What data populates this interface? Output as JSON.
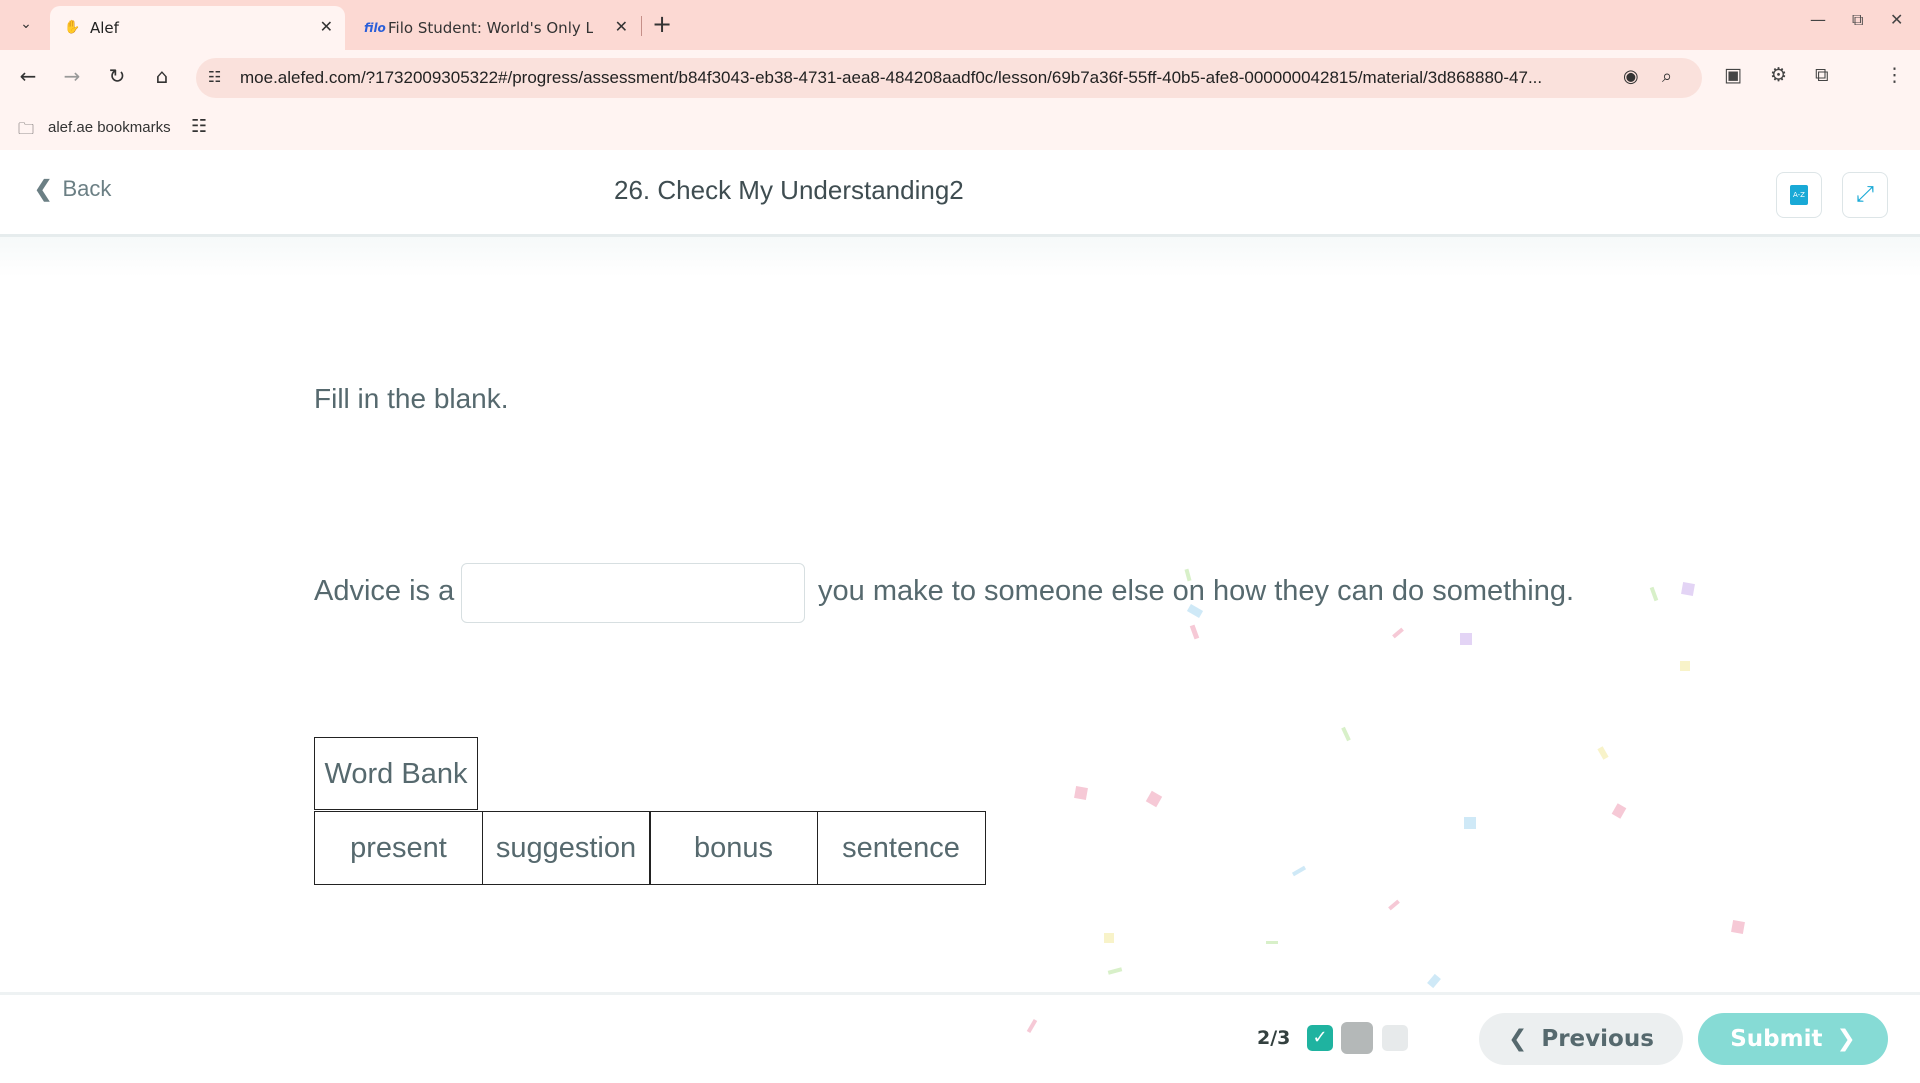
{
  "browser": {
    "tabs": [
      {
        "title": "Alef",
        "favicon": "alef-icon",
        "active": true
      },
      {
        "title": "Filo Student: World's Only Live I",
        "favicon": "filo",
        "active": false
      }
    ],
    "url": "moe.alefed.com/?1732009305322#/progress/assessment/b84f3043-eb38-4731-aea8-484208aadf0c/lesson/69b7a36f-55ff-40b5-afe8-000000042815/material/3d868880-47...",
    "bookmarks": {
      "folder_label": "alef.ae bookmarks"
    }
  },
  "header": {
    "back_label": "Back",
    "title": "26. Check My Understanding2"
  },
  "question": {
    "instruction": "Fill in the blank.",
    "sentence_before": "Advice is a",
    "sentence_after": "you make to someone else on how they can do something.",
    "blank_value": ""
  },
  "word_bank": {
    "title": "Word Bank",
    "words": [
      "present",
      "suggestion",
      "bonus",
      "sentence"
    ]
  },
  "footer": {
    "progress": "2/3",
    "previous_label": "Previous",
    "submit_label": "Submit"
  },
  "colors": {
    "chrome_tab_bar": "#fcd9d3",
    "accent_teal": "#1fb3a0",
    "submit_button": "#86dbd5",
    "icon_blue": "#19a9d6"
  }
}
